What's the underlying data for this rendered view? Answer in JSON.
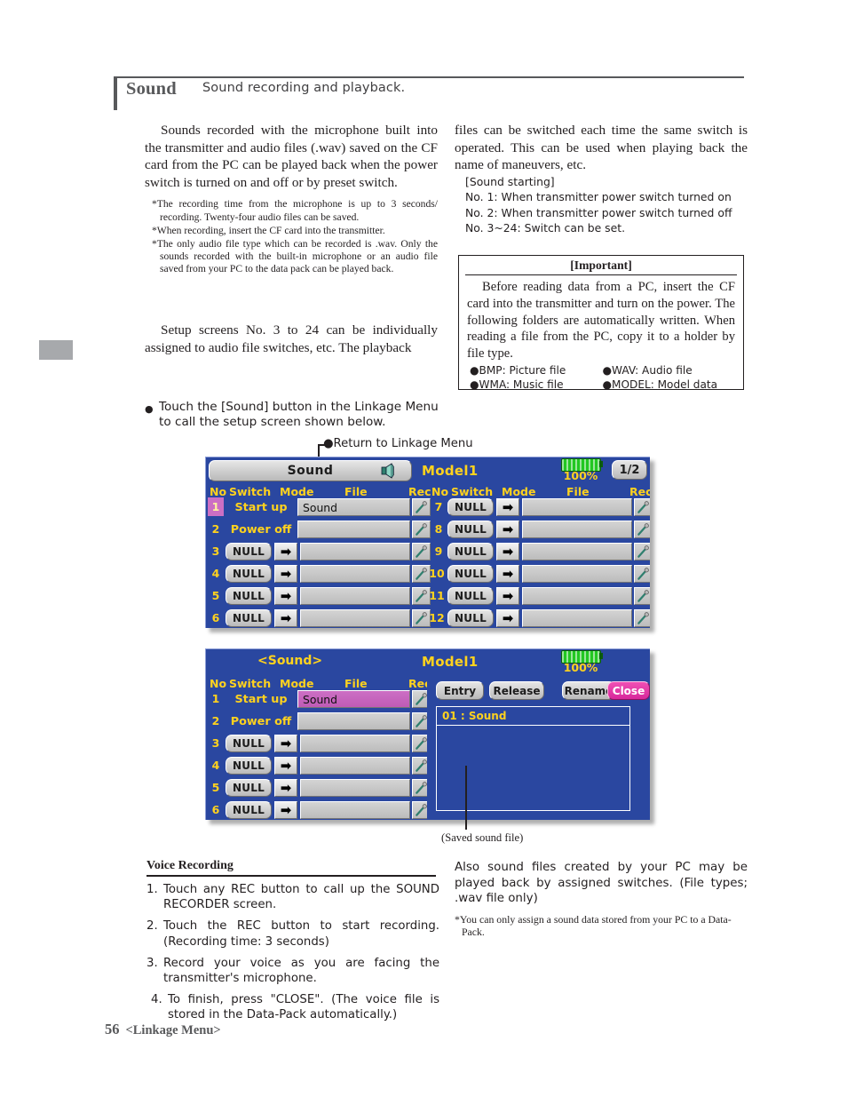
{
  "header": {
    "title": "Sound",
    "subtitle": "Sound recording and playback."
  },
  "left_column": {
    "intro": "Sounds recorded with the microphone built into the transmitter and audio files (.wav) saved on the CF card from the PC can be played back when the power switch is turned on and off or by preset switch.",
    "notes": [
      "*The recording time from the microphone is up to 3 seconds/ recording. Twenty-four audio files can be saved.",
      "*When recording, insert the CF card into the transmitter.",
      "*The only audio file type which can be recorded is .wav. Only the sounds recorded with the built-in microphone or an audio file saved from your PC to the data pack can be played back."
    ],
    "setup_para": "Setup screens No. 3 to 24 can be individually assigned to audio file switches, etc. The playback"
  },
  "right_column": {
    "continued": "files can be switched each time the same switch is operated. This can be used when playing back the name of maneuvers, etc.",
    "sound_starting_title": "[Sound starting]",
    "sound_starting_items": [
      "No. 1: When transmitter power switch turned on",
      "No. 2: When transmitter power switch turned off",
      "No. 3~24: Switch can be set."
    ]
  },
  "important": {
    "title": "[Important]",
    "body": "Before reading data from a PC, insert the CF card into the transmitter and turn on the power. The following folders are automatically written. When reading a file from the PC, copy it to a holder by file type.",
    "list_left": [
      "●BMP: Picture file",
      "●WMA: Music file"
    ],
    "list_right": [
      "●WAV: Audio file",
      "●MODEL: Model data"
    ]
  },
  "bullet": {
    "dot": "●",
    "text": "Touch the [Sound] button in the Linkage Menu to call the setup screen shown below."
  },
  "callouts": {
    "return_to_linkage": "●Return to Linkage Menu",
    "saved_sound_file": "(Saved sound file)"
  },
  "screen1": {
    "sound_button": "Sound",
    "speaker_icon": "speaker-icon",
    "model_name": "Model1",
    "battery_percent": "100%",
    "page_indicator": "1/2",
    "col_headers_left": [
      "No",
      "Switch",
      "Mode",
      "File",
      "Rec"
    ],
    "col_headers_right": [
      "No",
      "Switch",
      "Mode",
      "File",
      "Rec"
    ],
    "arrow_glyph": "➡",
    "rec_icon": "microphone-icon",
    "rows_left": [
      {
        "no": "1",
        "switch": "Start up",
        "switch_type": "static",
        "mode": "",
        "file": "Sound",
        "highlight_no": true,
        "file_highlight": false
      },
      {
        "no": "2",
        "switch": "Power off",
        "switch_type": "static",
        "mode": "",
        "file": "",
        "highlight_no": false,
        "file_highlight": false
      },
      {
        "no": "3",
        "switch": "NULL",
        "switch_type": "button",
        "mode": "arrow",
        "file": "",
        "highlight_no": false,
        "file_highlight": false
      },
      {
        "no": "4",
        "switch": "NULL",
        "switch_type": "button",
        "mode": "arrow",
        "file": "",
        "highlight_no": false,
        "file_highlight": false
      },
      {
        "no": "5",
        "switch": "NULL",
        "switch_type": "button",
        "mode": "arrow",
        "file": "",
        "highlight_no": false,
        "file_highlight": false
      },
      {
        "no": "6",
        "switch": "NULL",
        "switch_type": "button",
        "mode": "arrow",
        "file": "",
        "highlight_no": false,
        "file_highlight": false
      }
    ],
    "rows_right": [
      {
        "no": "7",
        "switch": "NULL",
        "switch_type": "button",
        "mode": "arrow",
        "file": ""
      },
      {
        "no": "8",
        "switch": "NULL",
        "switch_type": "button",
        "mode": "arrow",
        "file": ""
      },
      {
        "no": "9",
        "switch": "NULL",
        "switch_type": "button",
        "mode": "arrow",
        "file": ""
      },
      {
        "no": "10",
        "switch": "NULL",
        "switch_type": "button",
        "mode": "arrow",
        "file": ""
      },
      {
        "no": "11",
        "switch": "NULL",
        "switch_type": "button",
        "mode": "arrow",
        "file": ""
      },
      {
        "no": "12",
        "switch": "NULL",
        "switch_type": "button",
        "mode": "arrow",
        "file": ""
      }
    ]
  },
  "screen2": {
    "title": "<Sound>",
    "model_name": "Model1",
    "battery_percent": "100%",
    "col_headers": [
      "No",
      "Switch",
      "Mode",
      "File",
      "Rec"
    ],
    "rows": [
      {
        "no": "1",
        "switch": "Start up",
        "switch_type": "static",
        "mode": "",
        "file": "Sound",
        "file_highlight": true
      },
      {
        "no": "2",
        "switch": "Power off",
        "switch_type": "static",
        "mode": "",
        "file": "",
        "file_highlight": false
      },
      {
        "no": "3",
        "switch": "NULL",
        "switch_type": "button",
        "mode": "arrow",
        "file": "",
        "file_highlight": false
      },
      {
        "no": "4",
        "switch": "NULL",
        "switch_type": "button",
        "mode": "arrow",
        "file": "",
        "file_highlight": false
      },
      {
        "no": "5",
        "switch": "NULL",
        "switch_type": "button",
        "mode": "arrow",
        "file": "",
        "file_highlight": false
      },
      {
        "no": "6",
        "switch": "NULL",
        "switch_type": "button",
        "mode": "arrow",
        "file": "",
        "file_highlight": false
      }
    ],
    "dialog": {
      "entry_label": "Entry",
      "release_label": "Release",
      "rename_label": "Rename",
      "close_label": "Close",
      "list_item": "01 : Sound"
    }
  },
  "voice_recording": {
    "heading": "Voice Recording",
    "steps": [
      {
        "num": "1.",
        "text": "Touch any REC button to call up the SOUND RECORDER screen."
      },
      {
        "num": "2.",
        "text": "Touch the REC button to start recording. (Recording time: 3 seconds)"
      },
      {
        "num": "3.",
        "text": "Record your voice as you are facing the transmitter's microphone."
      },
      {
        "num": "4.",
        "text": "To finish, press \"CLOSE\". (The voice file is stored in the Data-Pack automatically.)"
      }
    ]
  },
  "bottom_right": {
    "para": "Also sound files created by your PC may be played back by assigned switches. (File types; .wav file only)",
    "footnote": "*You can only assign a sound data stored from your PC to a Data-Pack."
  },
  "footer": {
    "page_number": "56",
    "label": "<Linkage Menu>"
  },
  "colors": {
    "lcd_bg": "#2a47a0",
    "lcd_yellow": "#ffd21e",
    "magenta": "#cc6fc4",
    "close_pink": "#e0349e",
    "battery_green": "#22c722"
  }
}
